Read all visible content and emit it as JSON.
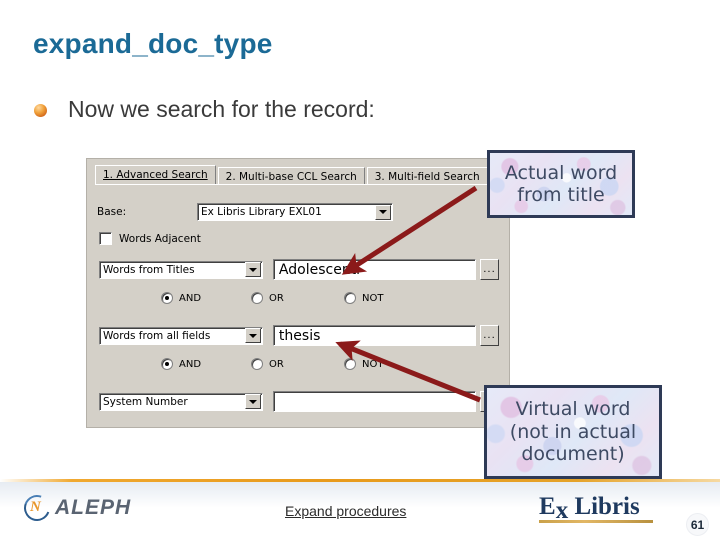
{
  "slide": {
    "title": "expand_doc_type",
    "bullet": "Now we search for the record:"
  },
  "dialog": {
    "tabs": [
      {
        "label": "1. Advanced Search",
        "active": true
      },
      {
        "label": "2. Multi-base CCL Search",
        "active": false
      },
      {
        "label": "3. Multi-field Search",
        "active": false
      }
    ],
    "base": {
      "label": "Base:",
      "value": "Ex Libris Library EXL01"
    },
    "words_adjacent": {
      "label": "Words Adjacent",
      "checked": false
    },
    "criteria": [
      {
        "field": "Words from Titles",
        "value": "Adolescenti",
        "browse_label": "..."
      },
      {
        "field": "Words from all fields",
        "value": "thesis",
        "browse_label": "..."
      },
      {
        "field": "System Number",
        "value": "",
        "browse_label": "..."
      }
    ],
    "operators": [
      {
        "and": "AND",
        "or": "OR",
        "not": "NOT",
        "selected": "AND"
      },
      {
        "and": "AND",
        "or": "OR",
        "not": "NOT",
        "selected": "AND"
      }
    ]
  },
  "callouts": {
    "actual": "Actual word\nfrom title",
    "actual_line1": "Actual word",
    "actual_line2": "from title",
    "virtual_line1": "Virtual word",
    "virtual_line2": "(not in actual",
    "virtual_line3": "document)"
  },
  "footer": {
    "aleph_logo_text": "ALEPH",
    "caption": "Expand procedures",
    "exlibris_ex": "E",
    "exlibris_x": "x",
    "exlibris_libris": " Libris",
    "page_number": "61"
  },
  "colors": {
    "title": "#1B6A96",
    "arrow": "#8B1A1A",
    "callout_border": "#2E3A56",
    "footer_rule": "#E89A1C",
    "dialog_face": "#D4D0C8"
  }
}
